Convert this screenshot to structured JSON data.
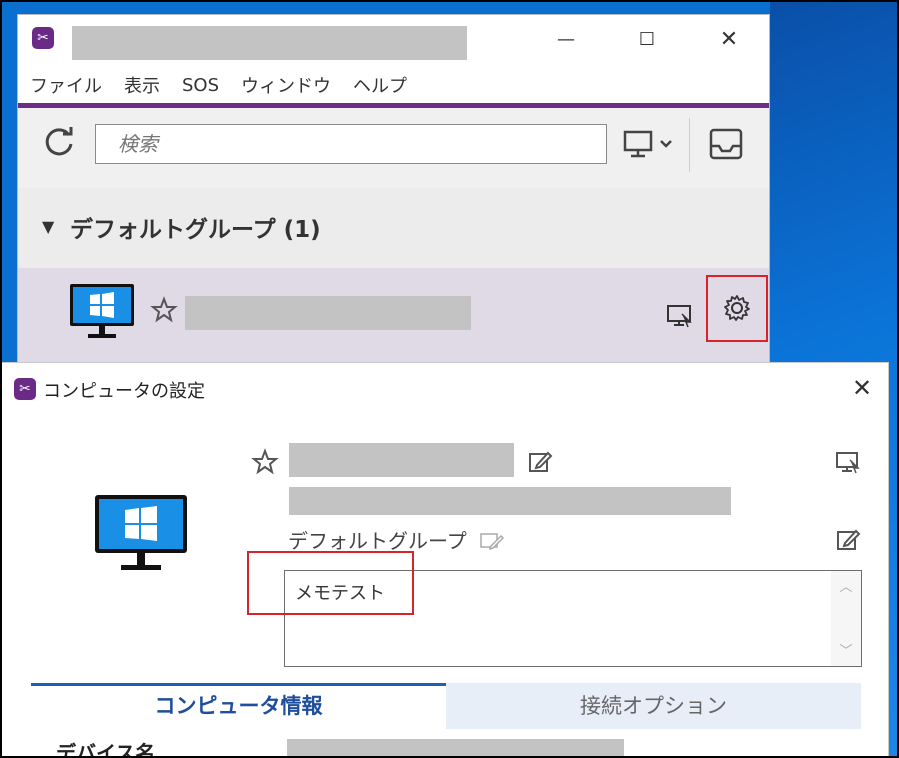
{
  "main_window": {
    "menu": [
      "ファイル",
      "表示",
      "SOS",
      "ウィンドウ",
      "ヘルプ"
    ],
    "controls": {
      "minimize": "—",
      "maximize": "☐",
      "close": "✕"
    },
    "search": {
      "placeholder": "検索",
      "value": ""
    },
    "group": {
      "caret": "▼",
      "title": "デフォルトグループ (1)"
    }
  },
  "dialog": {
    "title": "コンピュータの設定",
    "close": "✕",
    "group_name": "デフォルトグループ",
    "memo_text": "メモテスト",
    "scroll_up": "︿",
    "scroll_down": "﹀",
    "tabs": {
      "info": "コンピュータ情報",
      "options": "接続オプション"
    },
    "device_name_label": "デバイス名"
  },
  "colors": {
    "accent_purple": "#6b2d85",
    "highlight_red": "#d9232a",
    "tab_blue": "#1f4e9c"
  }
}
